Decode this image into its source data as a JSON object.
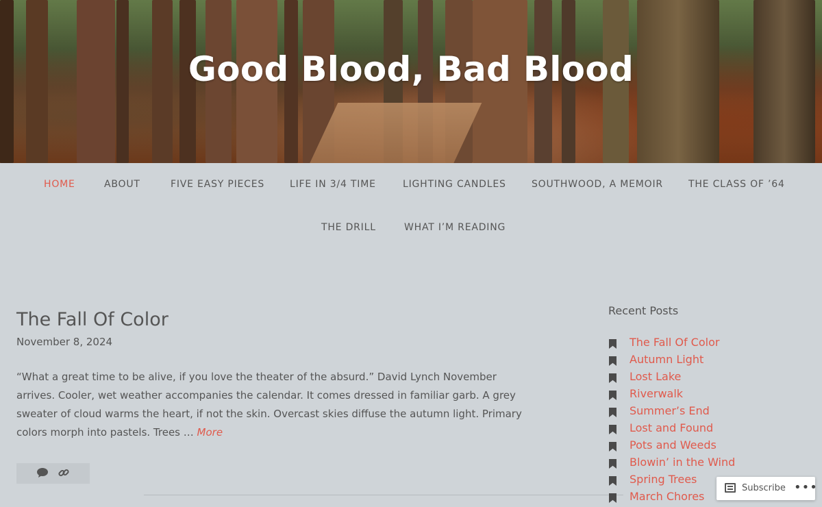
{
  "site": {
    "title": "Good Blood, Bad Blood"
  },
  "nav": {
    "row1": [
      "HOME",
      "ABOUT",
      "FIVE EASY PIECES",
      "LIFE IN 3/4 TIME",
      "LIGHTING CANDLES",
      "SOUTHWOOD, A MEMOIR",
      "THE CLASS OF ’64"
    ],
    "row2": [
      "THE DRILL",
      "WHAT I’M READING"
    ],
    "active": "HOME",
    "active_color": "#e05a4c"
  },
  "post": {
    "title": "The Fall Of Color",
    "date": "November 8, 2024",
    "excerpt": "“What a great time to be alive, if you love the theater of the absurd.” David Lynch November arrives. Cooler, wet weather accompanies the calendar. It comes dressed in familiar garb. A grey sweater of cloud warms the heart, if not the skin. Overcast skies diffuse the autumn light. Primary colors morph into pastels. Trees … ",
    "more_label": "More",
    "meta_icons": [
      "comment-icon",
      "link-icon"
    ]
  },
  "sidebar": {
    "recent_title": "Recent Posts",
    "recent_posts": [
      "The Fall Of Color",
      "Autumn Light",
      "Lost Lake",
      "Riverwalk",
      "Summer’s End",
      "Lost and Found",
      "Pots and Weeds",
      "Blowin’ in the Wind",
      "Spring Trees",
      "March Chores"
    ],
    "link_color": "#e05a4c"
  },
  "subscribe": {
    "label": "Subscribe",
    "menu": "•••"
  }
}
